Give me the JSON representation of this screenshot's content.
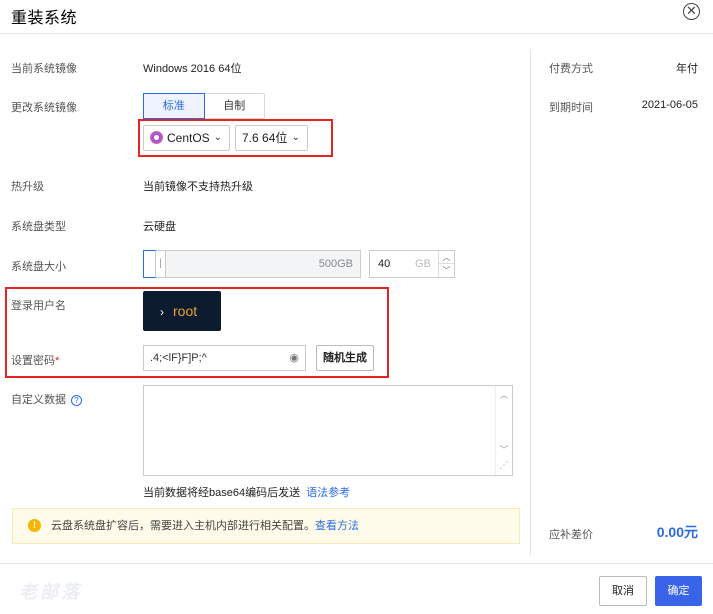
{
  "dialog": {
    "title": "重装系统",
    "close_icon": "close-circle-icon"
  },
  "current_image": {
    "label": "当前系统镜像",
    "value": "Windows 2016 64位"
  },
  "change_image": {
    "label": "更改系统镜像",
    "tabs": [
      {
        "label": "标准",
        "active": true
      },
      {
        "label": "自制",
        "active": false
      }
    ],
    "os_select": {
      "value": "CentOS",
      "icon": "centos-logo-icon"
    },
    "version_select": {
      "value": "7.6 64位"
    }
  },
  "hot_upgrade": {
    "label": "热升级",
    "value": "当前镜像不支持热升级"
  },
  "disk_type": {
    "label": "系统盘类型",
    "value": "云硬盘"
  },
  "disk_size": {
    "label": "系统盘大小",
    "slider_max": "500GB",
    "value": "40",
    "unit": "GB",
    "level": 0.08
  },
  "login_user": {
    "label": "登录用户名",
    "value": "root",
    "prompt": "›"
  },
  "password": {
    "label": "设置密码",
    "required_mark": "*",
    "value": ".4;<lF}F]P;^",
    "random_button": "随机生成"
  },
  "custom_data": {
    "label": "自定义数据",
    "help": "?",
    "note": "当前数据将经base64编码后发送",
    "link": "语法参考"
  },
  "warning": {
    "icon": "!",
    "text": "云盘系统盘扩容后，需要进入主机内部进行相关配置。",
    "link": "查看方法"
  },
  "billing": {
    "pay_label": "付费方式",
    "pay_value": "年付",
    "expire_label": "到期时间",
    "expire_value": "2021-06-05",
    "diff_label": "应补差价",
    "diff_value": "0.00元"
  },
  "footer": {
    "watermark": "老部落",
    "cancel": "取消",
    "ok": "确定"
  },
  "colors": {
    "accent": "#3a64e8",
    "highlight_box": "#e62424",
    "warning_bg": "#fefbea"
  }
}
